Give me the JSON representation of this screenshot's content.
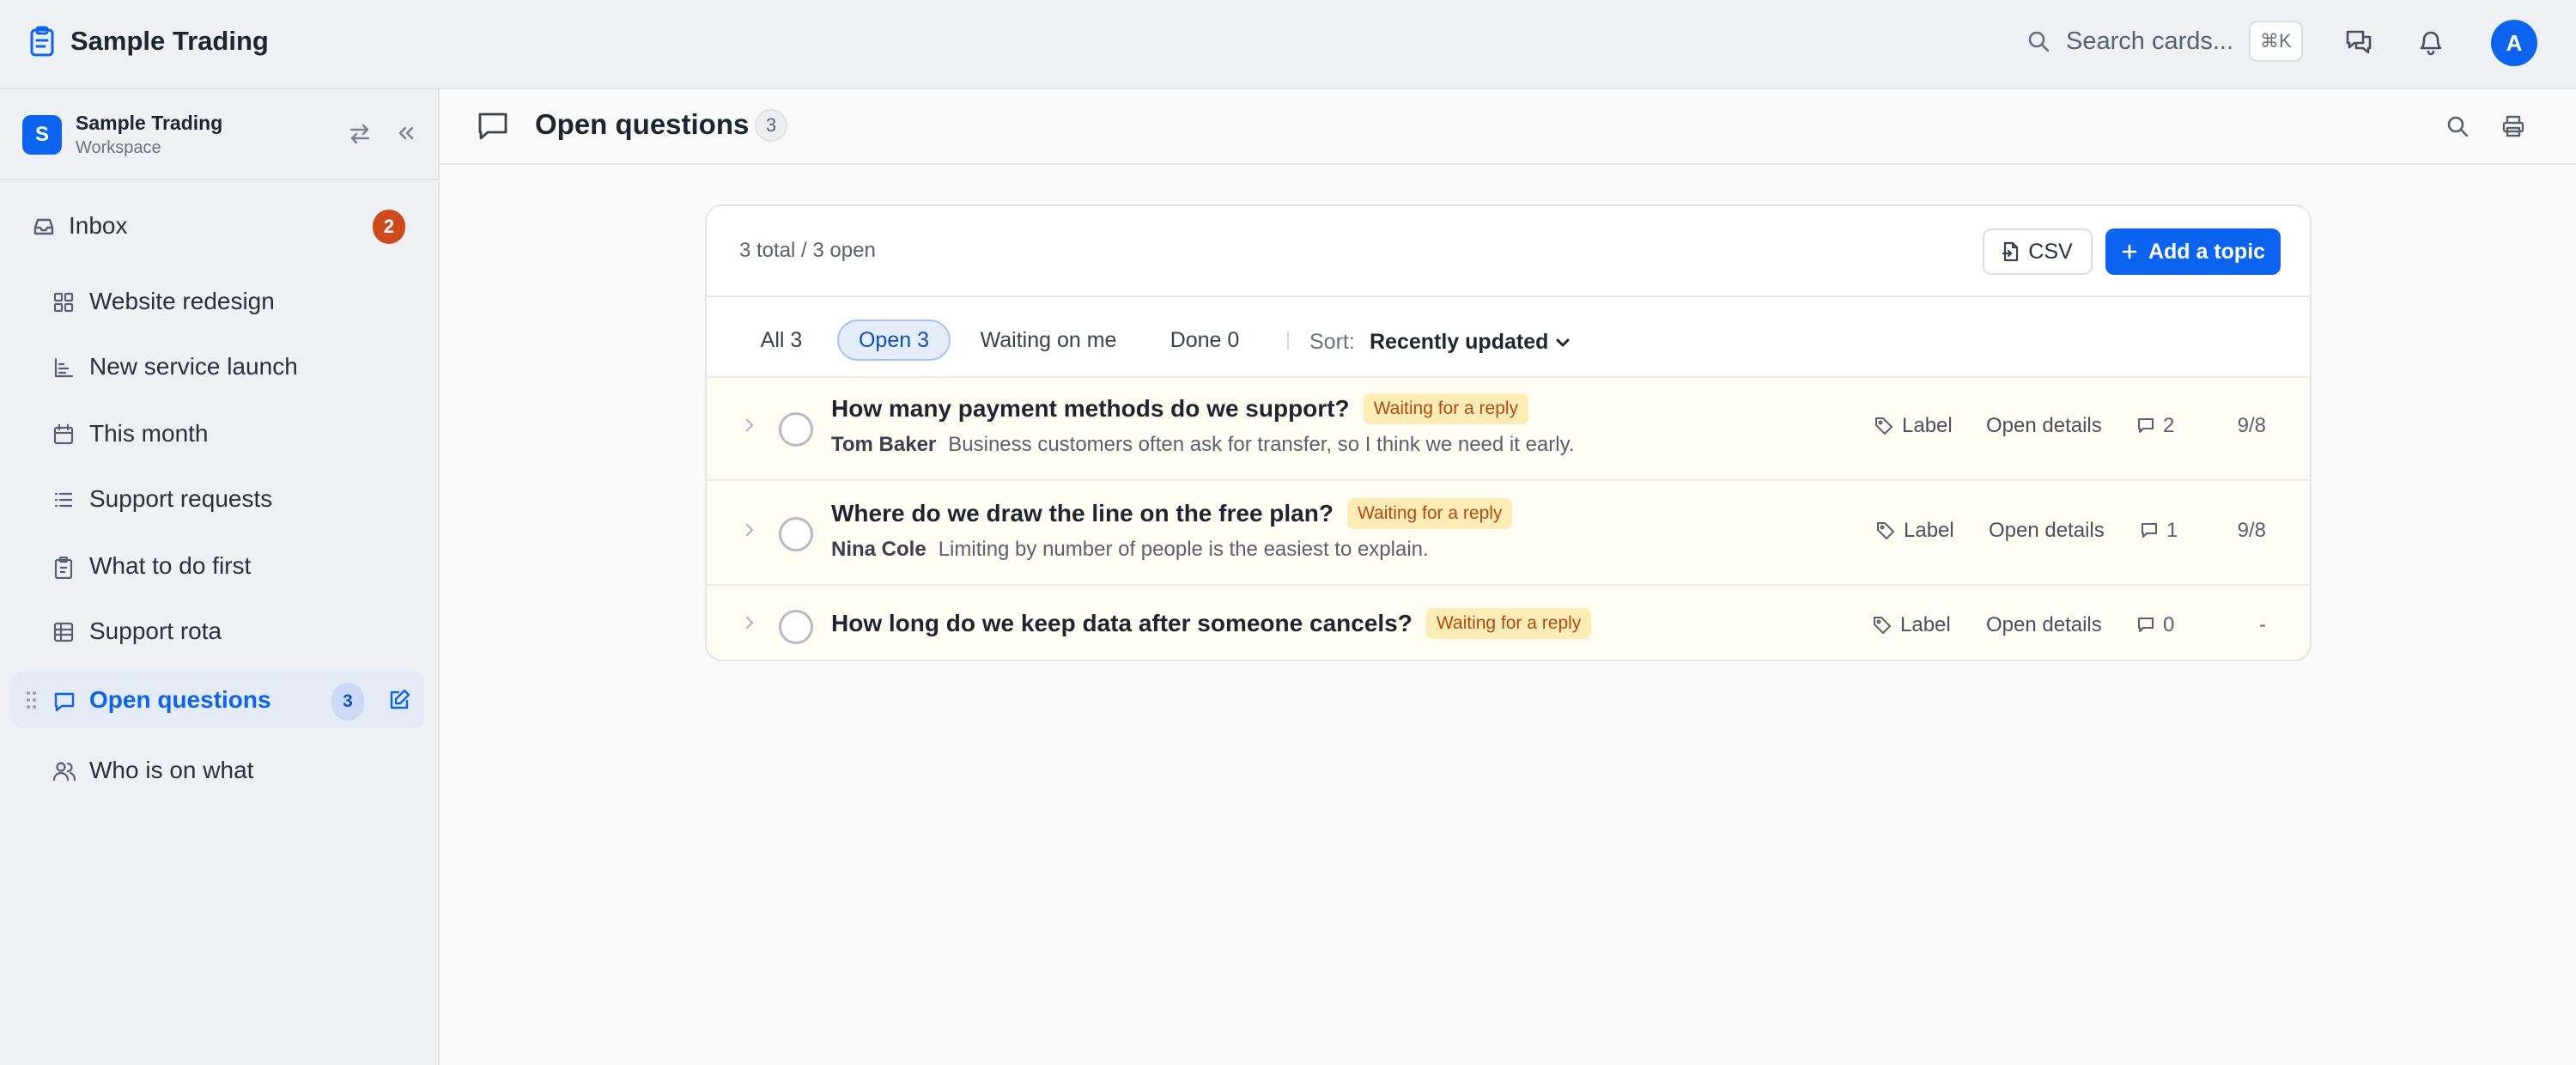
{
  "app": {
    "name": "Sample Trading"
  },
  "search": {
    "placeholder": "Search cards...",
    "shortcut": "⌘K"
  },
  "user": {
    "initial": "A"
  },
  "workspace": {
    "initial": "S",
    "name": "Sample Trading",
    "sub": "Workspace"
  },
  "sidebar": {
    "inbox": {
      "label": "Inbox",
      "count": "2"
    },
    "items": [
      {
        "label": "Website redesign",
        "icon": "grid-icon"
      },
      {
        "label": "New service launch",
        "icon": "bar-chart-icon"
      },
      {
        "label": "This month",
        "icon": "calendar-icon"
      },
      {
        "label": "Support requests",
        "icon": "list-icon"
      },
      {
        "label": "What to do first",
        "icon": "clipboard-icon"
      },
      {
        "label": "Support rota",
        "icon": "table-icon"
      },
      {
        "label": "Open questions",
        "icon": "chat-icon",
        "count": "3",
        "active": true
      },
      {
        "label": "Who is on what",
        "icon": "users-icon"
      }
    ]
  },
  "page": {
    "title": "Open questions",
    "count": "3"
  },
  "card": {
    "summary": "3 total / 3 open",
    "csv_label": "CSV",
    "add_label": "Add a topic",
    "filters": [
      {
        "label": "All 3",
        "active": false
      },
      {
        "label": "Open 3",
        "active": true
      },
      {
        "label": "Waiting on me",
        "active": false
      },
      {
        "label": "Done 0",
        "active": false
      }
    ],
    "sort_label": "Sort:",
    "sort_value": "Recently updated"
  },
  "rows": [
    {
      "question": "How many payment methods do we support?",
      "status": "Waiting for a reply",
      "author": "Tom Baker",
      "excerpt": "Business customers often ask for transfer, so I think we need it early.",
      "label": "Label",
      "details": "Open details",
      "comments": "2",
      "date": "9/8"
    },
    {
      "question": "Where do we draw the line on the free plan?",
      "status": "Waiting for a reply",
      "author": "Nina Cole",
      "excerpt": "Limiting by number of people is the easiest to explain.",
      "label": "Label",
      "details": "Open details",
      "comments": "1",
      "date": "9/8"
    },
    {
      "question": "How long do we keep data after someone cancels?",
      "status": "Waiting for a reply",
      "label": "Label",
      "details": "Open details",
      "comments": "0",
      "date": "-"
    }
  ],
  "colors": {
    "accent": "#0c63f0",
    "inbox_badge": "#cc4a1c",
    "pill_bg": "#fdecb6",
    "pill_text": "#b24a10"
  }
}
